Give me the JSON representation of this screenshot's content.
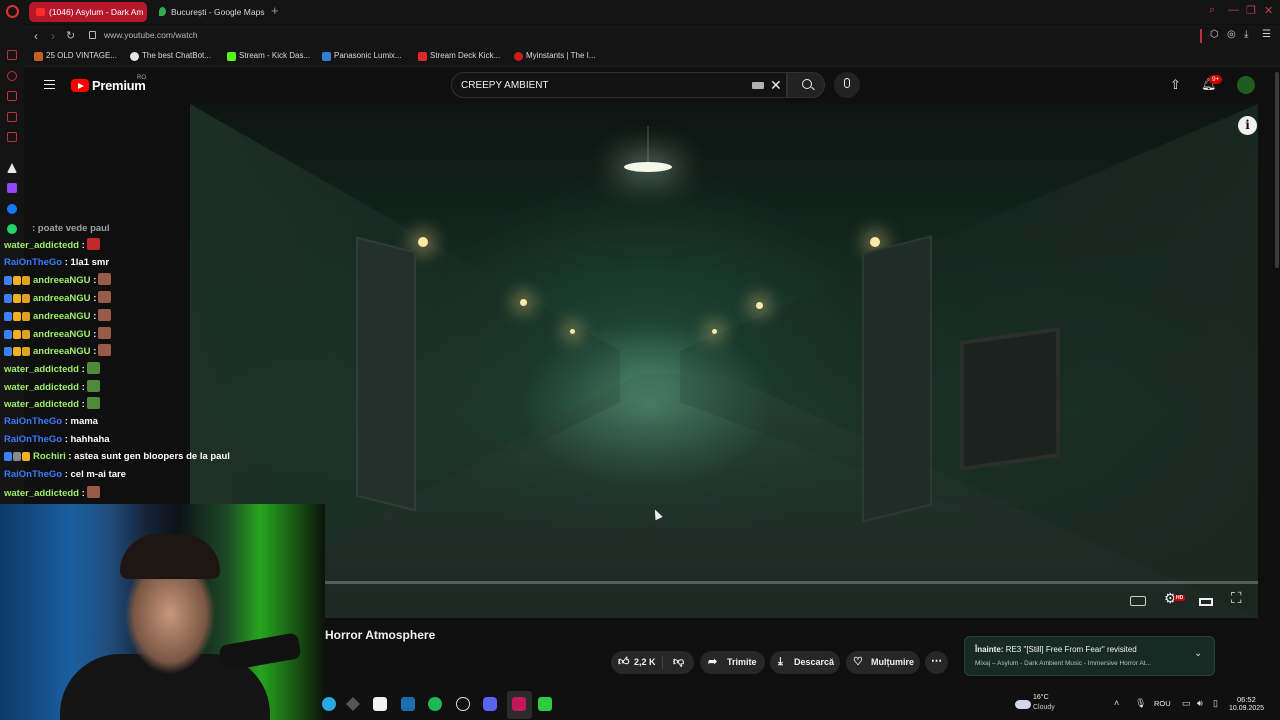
{
  "browser": {
    "tabs": [
      {
        "label": "(1046) Asylum - Dark Am",
        "active": true
      },
      {
        "label": "București - Google Maps",
        "active": false
      }
    ],
    "new_tab": "+",
    "url": "www.youtube.com/watch",
    "bookmarks": [
      {
        "label": "25 OLD VINTAGE...",
        "color": "#c75f1f"
      },
      {
        "label": "The best ChatBot...",
        "color": "#e6e6e6"
      },
      {
        "label": "Stream - Kick Das...",
        "color": "#53fc18"
      },
      {
        "label": "Panasonic Lumix...",
        "color": "#2f7fd6"
      },
      {
        "label": "Stream Deck Kick...",
        "color": "#e0262a"
      },
      {
        "label": "Myinstants | The I...",
        "color": "#d11c1c"
      }
    ]
  },
  "youtube": {
    "brand": "Premium",
    "region": "RO",
    "search_value": "CREEPY AMBIENT",
    "notification_count": "9+",
    "video_title": "Horror Atmosphere",
    "likes": "2,2 K",
    "share_label": "Trimite",
    "download_label": "Descarcă",
    "thanks_label": "Mulțumire",
    "up_next": {
      "label": "Înainte:",
      "title": "RE3 \"[Still] Free From Fear\" revisited",
      "subtitle": "Mixaj – Asylum - Dark Ambient Music - Immersive Horror At..."
    }
  },
  "chat": {
    "partial_line": ": poate vede paul",
    "messages": [
      {
        "user": "water_addictedd",
        "color": "green",
        "text": ":",
        "emote": "#c3282b",
        "badges": []
      },
      {
        "user": "RaiOnTheGo",
        "color": "blue",
        "text": ": 1la1 smr",
        "emote": null,
        "badges": []
      },
      {
        "user": "andreeaNGU",
        "color": "green",
        "text": ":",
        "emote": "#9a5a48",
        "badges": [
          "#3b82f6",
          "#f2b01e",
          "#e0a020"
        ]
      },
      {
        "user": "andreeaNGU",
        "color": "green",
        "text": ":",
        "emote": "#9a5a48",
        "badges": [
          "#3b82f6",
          "#f2b01e",
          "#e0a020"
        ]
      },
      {
        "user": "andreeaNGU",
        "color": "green",
        "text": ":",
        "emote": "#9a5a48",
        "badges": [
          "#3b82f6",
          "#f2b01e",
          "#e0a020"
        ]
      },
      {
        "user": "andreeaNGU",
        "color": "green",
        "text": ":",
        "emote": "#9a5a48",
        "badges": [
          "#3b82f6",
          "#f2b01e",
          "#e0a020"
        ]
      },
      {
        "user": "andreeaNGU",
        "color": "green",
        "text": ":",
        "emote": "#9a5a48",
        "badges": [
          "#3b82f6",
          "#f2b01e",
          "#e0a020"
        ]
      },
      {
        "user": "water_addictedd",
        "color": "green",
        "text": ":",
        "emote": "#4f8a3a",
        "badges": []
      },
      {
        "user": "water_addictedd",
        "color": "green",
        "text": ":",
        "emote": "#4f8a3a",
        "badges": []
      },
      {
        "user": "water_addictedd",
        "color": "green",
        "text": ":",
        "emote": "#4f8a3a",
        "badges": []
      },
      {
        "user": "RaiOnTheGo",
        "color": "blue",
        "text": ": mama",
        "emote": null,
        "badges": []
      },
      {
        "user": "RaiOnTheGo",
        "color": "blue",
        "text": ": hahhaha",
        "emote": null,
        "badges": []
      },
      {
        "user": "Rochiri",
        "color": "green",
        "text": ": astea sunt gen bloopers de la paul",
        "emote": null,
        "badges": [
          "#3b82f6",
          "#8a8a8a",
          "#f2b01e"
        ]
      },
      {
        "user": "RaiOnTheGo",
        "color": "blue",
        "text": ": cel m-ai tare",
        "emote": null,
        "badges": []
      },
      {
        "user": "water_addictedd",
        "color": "green",
        "text": ":",
        "emote": "#9a5a48",
        "badges": []
      }
    ]
  },
  "taskbar": {
    "weather_temp": "16°C",
    "weather_state": "Cloudy",
    "language": "ROU",
    "time": "06:52",
    "date": "10.09.2025"
  }
}
